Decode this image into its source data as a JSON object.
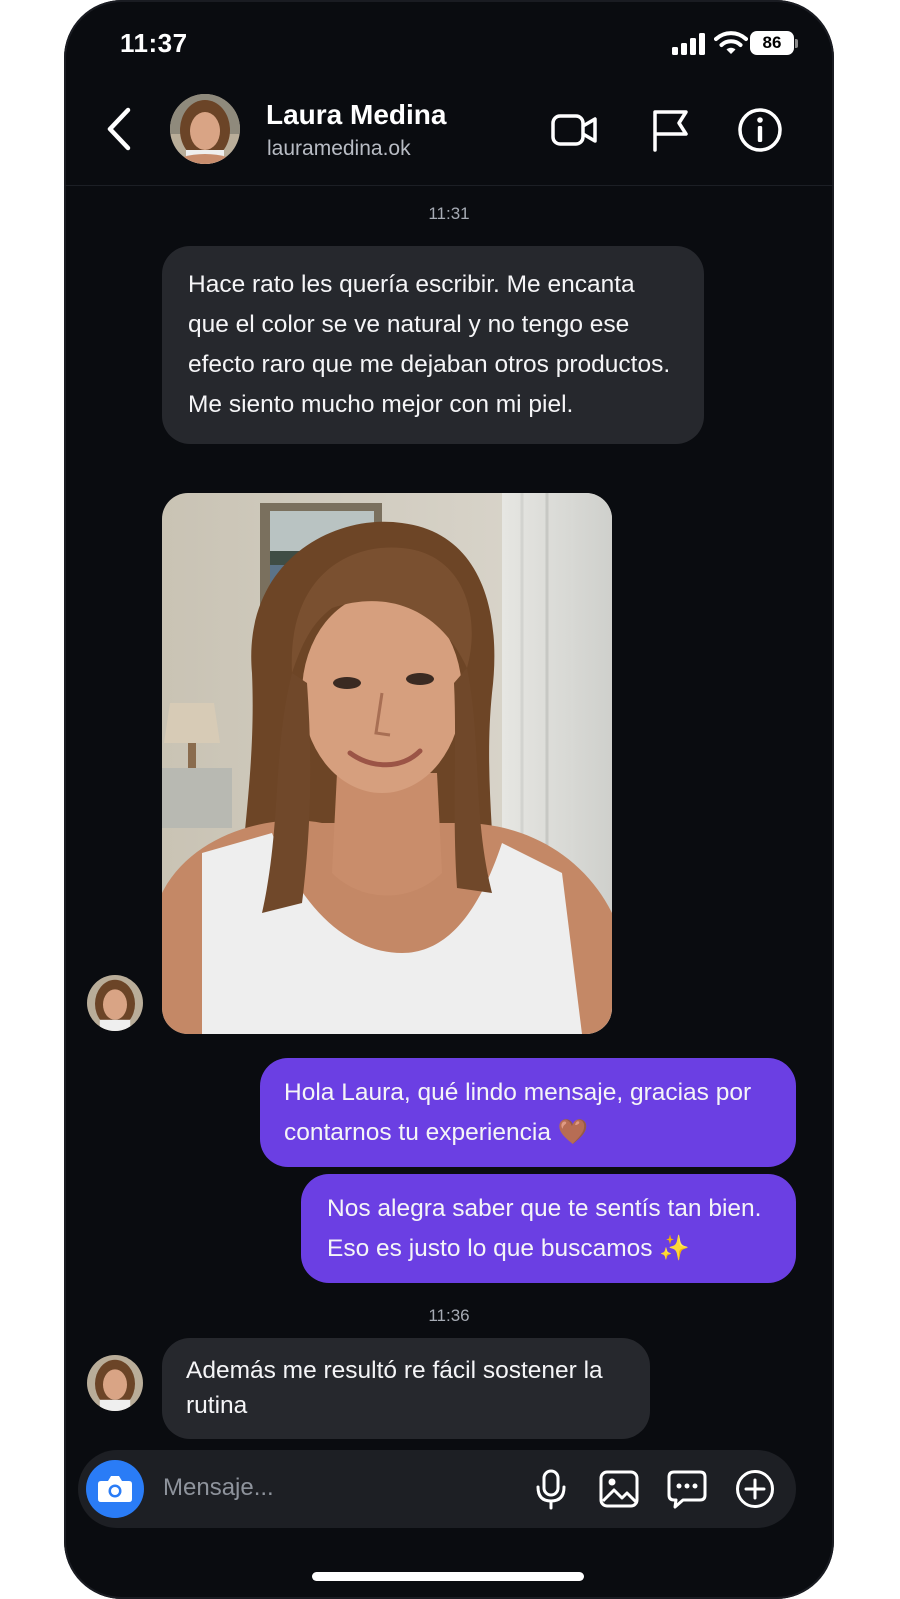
{
  "status_bar": {
    "time": "11:37",
    "battery": "86"
  },
  "header": {
    "name": "Laura Medina",
    "handle": "lauramedina.ok"
  },
  "icons": {
    "back": "chevron-left-icon",
    "video": "video-camera-icon",
    "flag": "flag-icon",
    "info": "info-icon",
    "camera": "camera-icon",
    "mic": "microphone-icon",
    "gallery": "image-icon",
    "sticker": "chat-bubble-icon",
    "plus": "plus-circle-icon"
  },
  "conversation": {
    "timestamp_1": "11:31",
    "msg_1": "Hace rato les quería escribir. Me encanta que el color se ve natural y no tengo ese efecto raro que me dejaban otros productos. Me siento mucho mejor con mi piel.",
    "reply_1": "Hola Laura,  qué lindo mensaje, gracias por contarnos tu experiencia 🤎",
    "reply_2": "Nos alegra saber que te sentís tan bien. Eso es justo lo que buscamos ✨",
    "timestamp_2": "11:36",
    "msg_2": "Además me resultó re fácil sostener la rutina"
  },
  "composer": {
    "placeholder": "Mensaje..."
  },
  "colors": {
    "background": "#0a0c10",
    "incoming_bubble": "#26282d",
    "outgoing_bubble": "#6b3fe3",
    "camera_button": "#2a7cf6"
  }
}
